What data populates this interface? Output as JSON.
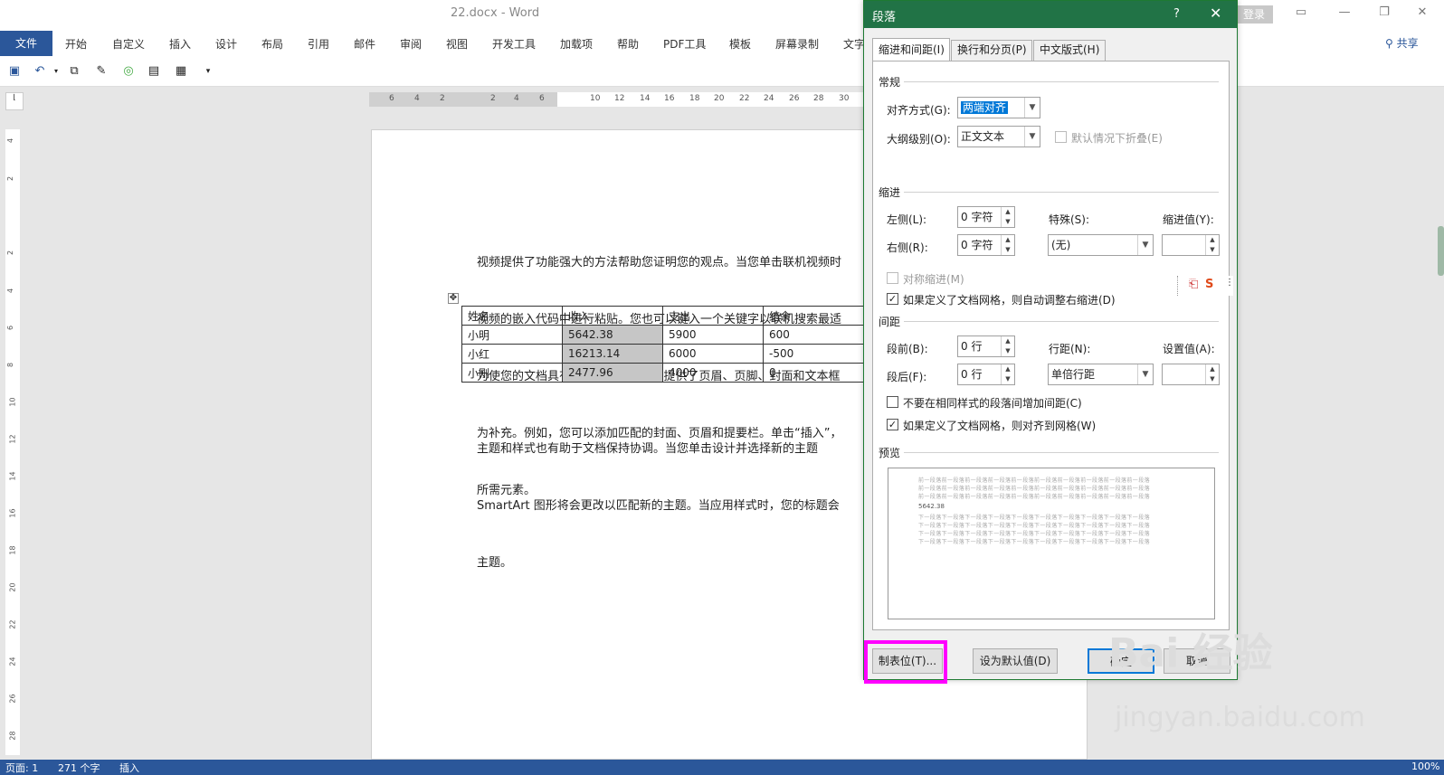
{
  "window": {
    "doc_title": "22.docx - Word",
    "login": "登录",
    "share": "共享"
  },
  "menu": {
    "file": "文件",
    "items": [
      "开始",
      "自定义",
      "插入",
      "设计",
      "布局",
      "引用",
      "邮件",
      "审阅",
      "视图",
      "开发工具",
      "加载项",
      "帮助",
      "PDF工具",
      "模板",
      "屏幕录制",
      "文字"
    ]
  },
  "ruler": {
    "h_ticks": [
      "6",
      "4",
      "2",
      "2",
      "4",
      "6",
      "10",
      "12",
      "14",
      "16",
      "18",
      "20",
      "22",
      "24",
      "26",
      "28",
      "30"
    ],
    "v_ticks": [
      "4",
      "2",
      "2",
      "4",
      "6",
      "8",
      "10",
      "12",
      "14",
      "16",
      "18",
      "20",
      "22",
      "24",
      "26",
      "28"
    ]
  },
  "document": {
    "para1": [
      "视频提供了功能强大的方法帮助您证明您的观点。当您单击联机视频时",
      "视频的嵌入代码中进行粘贴。您也可以键入一个关键字以联机搜索最适",
      "为使您的文档具有专业外观，Word 提供了页眉、页脚、封面和文本框",
      "为补充。例如，您可以添加匹配的封面、页眉和提要栏。单击“插入”，",
      "所需元素。"
    ],
    "table": {
      "headers": [
        "姓名",
        "收入",
        "支出",
        "结余"
      ],
      "rows": [
        [
          "小明",
          "5642.38",
          "5900",
          "600"
        ],
        [
          "小红",
          "16213.14",
          "6000",
          "-500"
        ],
        [
          "小刚",
          "2477.96",
          "4000",
          "0"
        ]
      ]
    },
    "para2": [
      "主题和样式也有助于文档保持协调。当您单击设计并选择新的主题",
      "SmartArt 图形将会更改以匹配新的主题。当应用样式时，您的标题会",
      "主题。"
    ]
  },
  "status": {
    "page": "页面: 1",
    "words": "271 个字",
    "mode": "插入",
    "zoom": "100%"
  },
  "dialog": {
    "title": "段落",
    "help": "?",
    "tabs": [
      "缩进和间距(I)",
      "换行和分页(P)",
      "中文版式(H)"
    ],
    "general": {
      "heading": "常规",
      "align_label": "对齐方式(G):",
      "align_value": "两端对齐",
      "outline_label": "大纲级别(O):",
      "outline_value": "正文文本",
      "collapse_label": "默认情况下折叠(E)"
    },
    "indent": {
      "heading": "缩进",
      "left_label": "左侧(L):",
      "left_value": "0 字符",
      "right_label": "右侧(R):",
      "right_value": "0 字符",
      "special_label": "特殊(S):",
      "special_value": "(无)",
      "indent_value_label": "缩进值(Y):",
      "mirror_label": "对称缩进(M)",
      "auto_right_label": "如果定义了文档网格，则自动调整右缩进(D)"
    },
    "spacing": {
      "heading": "间距",
      "before_label": "段前(B):",
      "before_value": "0 行",
      "after_label": "段后(F):",
      "after_value": "0 行",
      "line_label": "行距(N):",
      "line_value": "单倍行距",
      "setting_label": "设置值(A):",
      "no_space_label": "不要在相同样式的段落间增加间距(C)",
      "snap_grid_label": "如果定义了文档网格，则对齐到网格(W)"
    },
    "preview": {
      "heading": "预览",
      "prev_text": "前一段落前一段落前一段落前一段落前一段落前一段落前一段落前一段落前一段落前一段落",
      "sample": "5642.38",
      "next_text": "下一段落下一段落下一段落下一段落下一段落下一段落下一段落下一段落下一段落下一段落"
    },
    "buttons": {
      "tabs": "制表位(T)...",
      "default": "设为默认值(D)",
      "ok": "确定",
      "cancel": "取消"
    }
  },
  "watermark": {
    "main": "Bai 经验",
    "sub": "jingyan.baidu.com"
  },
  "colors": {
    "accent": "#2b579a",
    "dialog_title": "#217346",
    "highlight": "#ff00ff"
  }
}
